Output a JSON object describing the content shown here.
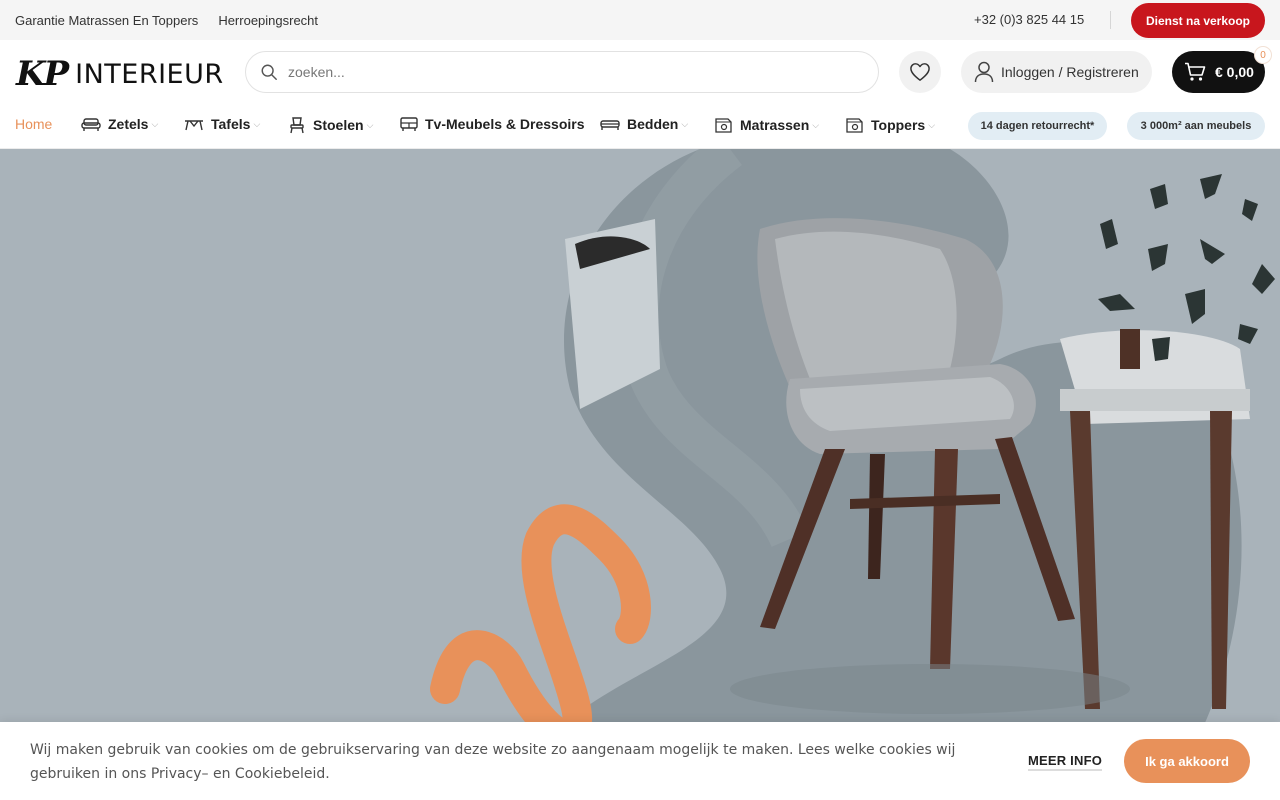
{
  "topbar": {
    "links": [
      "Garantie Matrassen En Toppers",
      "Herroepingsrecht"
    ],
    "phone": "+32 (0)3 825 44 15",
    "service_button": "Dienst na verkoop"
  },
  "header": {
    "logo_mark": "KP",
    "logo_word": "INTERIEUR",
    "search_placeholder": "zoeken...",
    "login_label": "Inloggen / Registreren",
    "cart_total": "€ 0,00",
    "cart_count": "0"
  },
  "nav": {
    "items": [
      {
        "label": "Home",
        "icon": "none",
        "active": true
      },
      {
        "label": "Zetels",
        "icon": "sofa-icon",
        "dropdown": true
      },
      {
        "label": "Tafels",
        "icon": "table-icon",
        "dropdown": true
      },
      {
        "label": "Stoelen",
        "icon": "chair-icon",
        "dropdown": true
      },
      {
        "label": "Tv-Meubels & Dressoirs",
        "icon": "tv-cabinet-icon",
        "dropdown": false
      },
      {
        "label": "Bedden",
        "icon": "bed-icon",
        "dropdown": true
      },
      {
        "label": "Matrassen",
        "icon": "mattress-icon",
        "dropdown": true
      },
      {
        "label": "Toppers",
        "icon": "topper-icon",
        "dropdown": true
      }
    ],
    "pills": [
      "14 dagen retourrecht*",
      "3 000m² aan meubels"
    ]
  },
  "cookie": {
    "message": "Wij maken gebruik van cookies om de gebruikservaring van deze website zo aangenaam mogelijk te maken. Lees welke cookies wij gebruiken in ons Privacy– en Cookiebeleid.",
    "more_info": "MEER INFO",
    "agree": "Ik ga akkoord"
  },
  "colors": {
    "accent": "#e8915a",
    "service_red": "#c8161d",
    "pill_bg": "#e2edf4",
    "hero_bg": "#a9b3ba"
  }
}
